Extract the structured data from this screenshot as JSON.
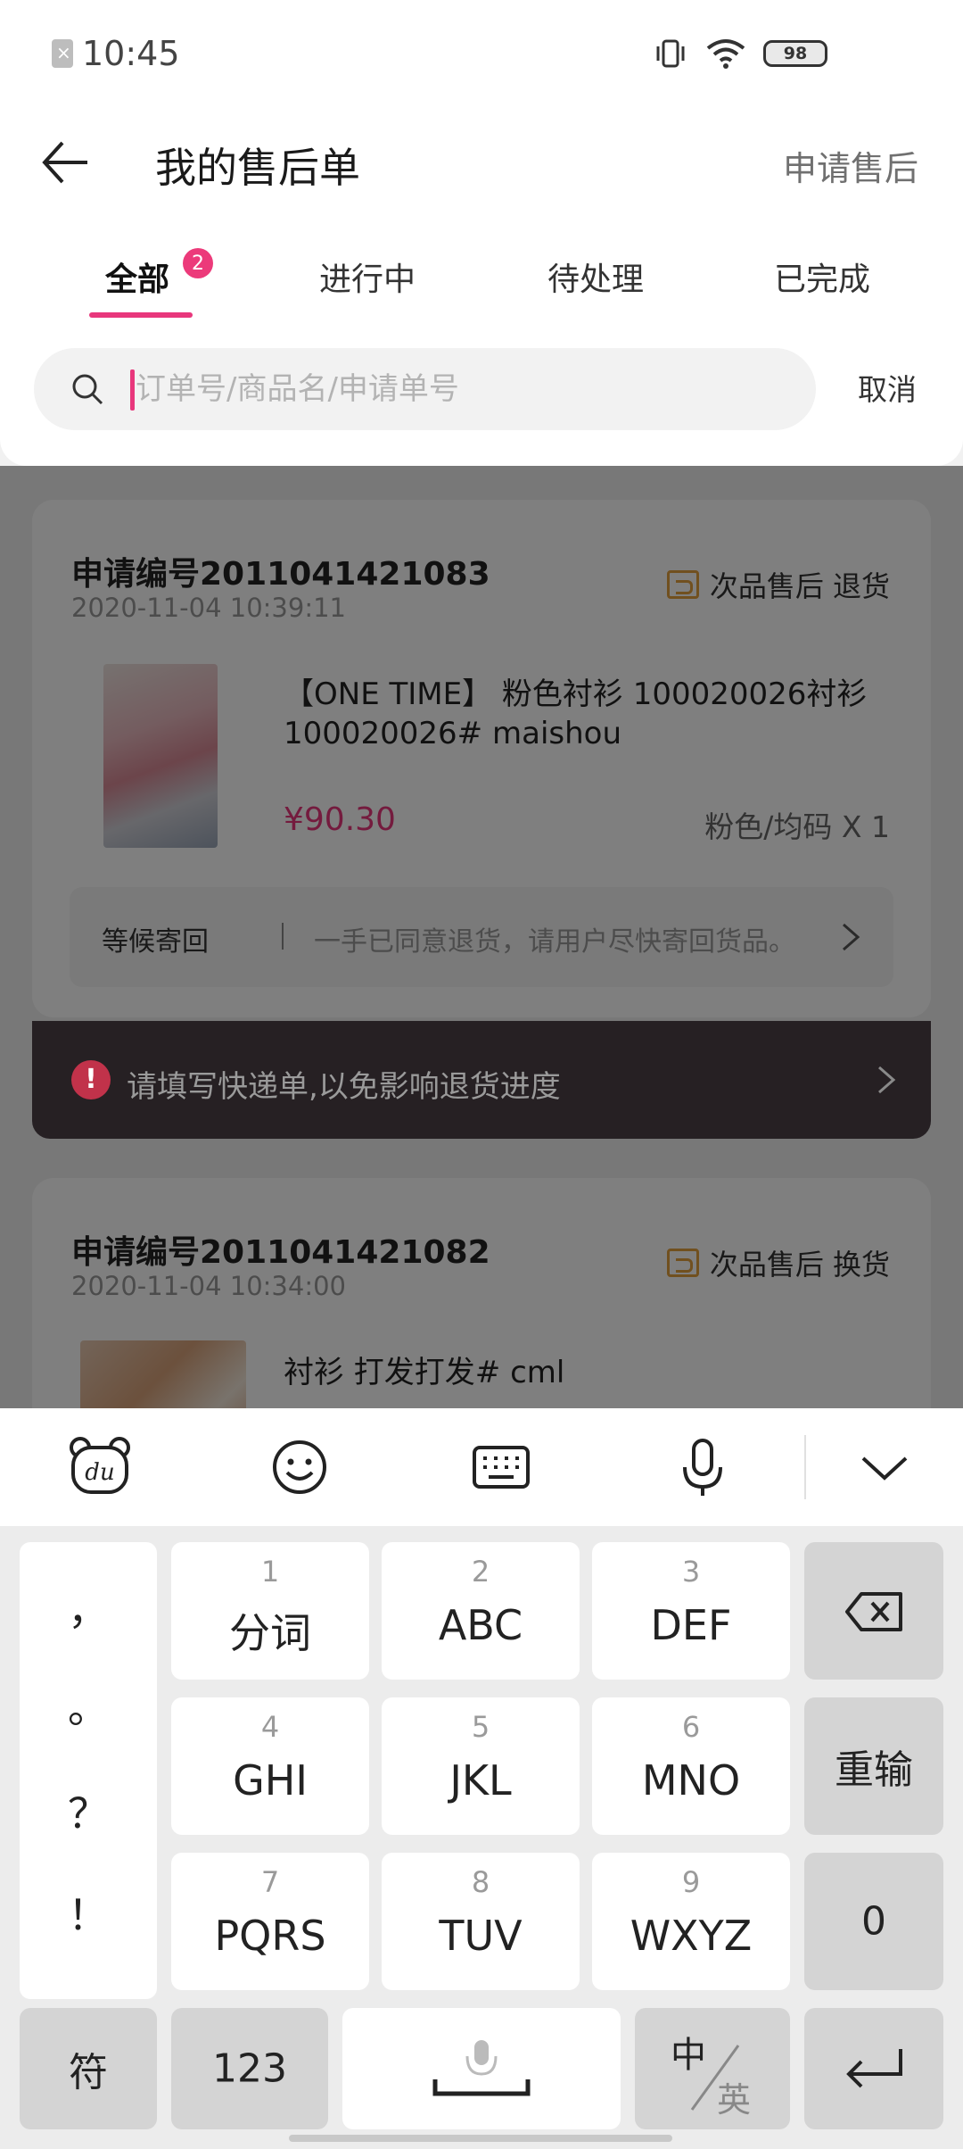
{
  "status_bar": {
    "time": "10:45",
    "battery": "98"
  },
  "header": {
    "title": "我的售后单",
    "apply_label": "申请售后"
  },
  "tabs": [
    {
      "label": "全部",
      "badge": "2",
      "active": true
    },
    {
      "label": "进行中"
    },
    {
      "label": "待处理"
    },
    {
      "label": "已完成"
    }
  ],
  "search": {
    "placeholder": "订单号/商品名/申请单号",
    "value": "",
    "cancel_label": "取消"
  },
  "orders": [
    {
      "order_no": "申请编号2011041421083",
      "time": "2020-11-04 10:39:11",
      "tag": "次品售后 退货",
      "product_name": "【ONE TIME】 粉色衬衫 100020026衬衫 100020026#  maishou",
      "price": "¥90.30",
      "spec": "粉色/均码 X 1",
      "status_title": "等候寄回",
      "status_desc": "一手已同意退货，请用户尽快寄回货品。"
    },
    {
      "order_no": "申请编号2011041421082",
      "time": "2020-11-04 10:34:00",
      "tag": "次品售后 换货",
      "product_name": "衬衫  打发打发#  cml"
    }
  ],
  "notice": {
    "text": "请填写快递单,以免影响退货进度"
  },
  "keyboard": {
    "toolbar_icons": [
      "du-logo-icon",
      "emoji-icon",
      "keyboard-icon",
      "microphone-icon",
      "collapse-chevron-icon"
    ],
    "punctuation": [
      "，",
      "。",
      "？",
      "！"
    ],
    "keys": [
      {
        "num": "1",
        "label": "分词"
      },
      {
        "num": "2",
        "label": "ABC"
      },
      {
        "num": "3",
        "label": "DEF"
      },
      {
        "num": "4",
        "label": "GHI"
      },
      {
        "num": "5",
        "label": "JKL"
      },
      {
        "num": "6",
        "label": "MNO"
      },
      {
        "num": "7",
        "label": "PQRS"
      },
      {
        "num": "8",
        "label": "TUV"
      },
      {
        "num": "9",
        "label": "WXYZ"
      }
    ],
    "reenter_label": "重输",
    "zero_label": "0",
    "symbol_label": "符",
    "number_label": "123",
    "lang_cn": "中",
    "lang_en": "英"
  },
  "colors": {
    "accent": "#e8377c",
    "tag_orange": "#e3a03e",
    "alert_red": "#c1324a"
  }
}
